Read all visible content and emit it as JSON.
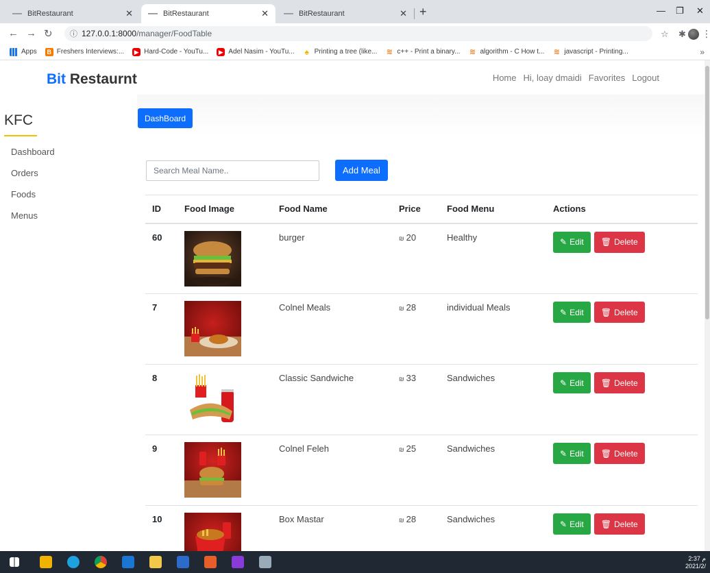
{
  "browser": {
    "tabs": [
      {
        "title": "BitRestaurant"
      },
      {
        "title": "BitRestaurant"
      },
      {
        "title": "BitRestaurant"
      }
    ],
    "url_host": "127.0.0.1:8000",
    "url_path": "/manager/FoodTable",
    "bookmarks": [
      {
        "label": "Apps",
        "icon": "apps-grid-icon"
      },
      {
        "label": "Freshers Interviews:...",
        "icon": "blogger-icon"
      },
      {
        "label": "Hard-Code - YouTu...",
        "icon": "youtube-icon"
      },
      {
        "label": "Adel Nasim - YouTu...",
        "icon": "youtube-icon"
      },
      {
        "label": "Printing a tree (like...",
        "icon": "tree-icon"
      },
      {
        "label": "c++ - Print a binary...",
        "icon": "stackoverflow-icon"
      },
      {
        "label": "algorithm - C How t...",
        "icon": "stackoverflow-icon"
      },
      {
        "label": "javascript - Printing...",
        "icon": "stackoverflow-icon"
      }
    ]
  },
  "navbar": {
    "brand_accent": "Bit",
    "brand_rest": " Restaurnt",
    "links": [
      "Home",
      "Hi, loay dmaidi",
      "Favorites",
      "Logout"
    ]
  },
  "sidebar": {
    "title": "KFC",
    "items": [
      "Dashboard",
      "Orders",
      "Foods",
      "Menus"
    ]
  },
  "main": {
    "dashboard_button": "DashBoard",
    "search_placeholder": "Search Meal Name..",
    "add_button": "Add Meal",
    "edit_label": "Edit",
    "delete_label": "Delete",
    "currency": "₪",
    "columns": [
      "ID",
      "Food Image",
      "Food Name",
      "Price",
      "Food Menu",
      "Actions"
    ],
    "rows": [
      {
        "id": "60",
        "name": "burger",
        "price": "20",
        "menu": "Healthy",
        "image": "burger"
      },
      {
        "id": "7",
        "name": "Colnel Meals",
        "price": "28",
        "menu": "individual Meals",
        "image": "chicken-meal"
      },
      {
        "id": "8",
        "name": "Classic Sandwiche",
        "price": "33",
        "menu": "Sandwiches",
        "image": "sandwich-cola"
      },
      {
        "id": "9",
        "name": "Colnel Feleh",
        "price": "25",
        "menu": "Sandwiches",
        "image": "burger-red"
      },
      {
        "id": "10",
        "name": "Box Mastar",
        "price": "28",
        "menu": "Sandwiches",
        "image": "box-meal"
      }
    ]
  },
  "taskbar": {
    "time": "2:37 م",
    "date": "2021/2/"
  },
  "colors": {
    "primary": "#0d6efd",
    "success": "#28a745",
    "danger": "#dc3545",
    "accent_line": "#f2c200"
  }
}
